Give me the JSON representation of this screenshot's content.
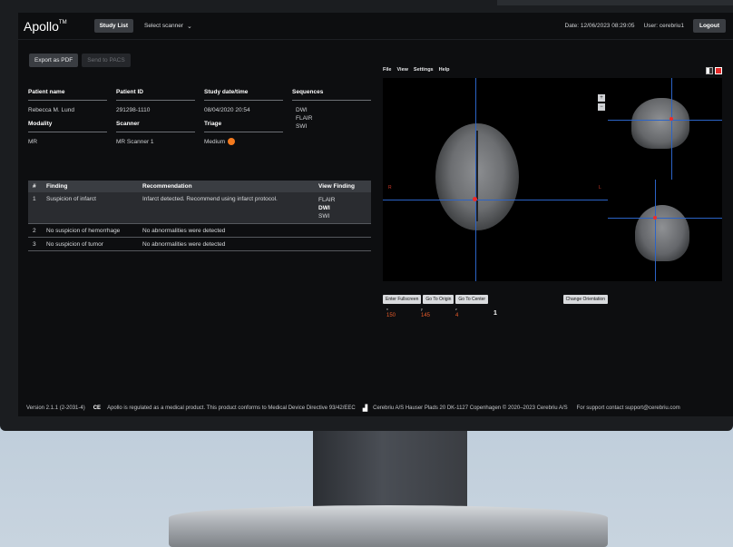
{
  "app": {
    "brand": "Apollo",
    "brand_tm": "TM",
    "tab_study_list": "Study List",
    "scanner_select": "Select scanner",
    "date": "Date: 12/06/2023 08:29:05",
    "user": "User: cerebriu1",
    "logout": "Logout"
  },
  "actions": {
    "export_pdf": "Export as PDF",
    "send_pacs": "Send to PACS"
  },
  "patient": {
    "name_label": "Patient name",
    "name_value": "Rebecca M. Lund",
    "id_label": "Patient ID",
    "id_value": "291298-1110",
    "date_label": "Study date/time",
    "date_value": "08/04/2020 20:54",
    "sequences_label": "Sequences",
    "sequences": [
      "DWI",
      "FLAIR",
      "SWI"
    ],
    "modality_label": "Modality",
    "modality_value": "MR",
    "scanner_label": "Scanner",
    "scanner_value": "MR Scanner 1",
    "triage_label": "Triage",
    "triage_value": "Medium",
    "triage_color": "#f47a1e"
  },
  "findings": {
    "headers": [
      "#",
      "Finding",
      "Recommendation",
      "View Finding"
    ],
    "rows": [
      {
        "num": "1",
        "finding": "Suspicion of infarct",
        "rec": "Infarct detected. Recommend using infarct protocol.",
        "views": [
          "FLAIR",
          "DWI",
          "SWI"
        ]
      },
      {
        "num": "2",
        "finding": "No suspicion of hemorrhage",
        "rec": "No abnormalities were detected"
      },
      {
        "num": "3",
        "finding": "No suspicion of tumor",
        "rec": "No abnormalities were detected"
      }
    ]
  },
  "viewer": {
    "menu": [
      "File",
      "View",
      "Settings",
      "Help"
    ],
    "orient_left": "R",
    "orient_right": "L",
    "zoom_in": "+",
    "zoom_out": "−",
    "btn_fullscreen": "Enter Fullscreen",
    "btn_origin": "Go To Origin",
    "btn_center": "Go To Center",
    "btn_orientation": "Change Orientation",
    "coord_labels": [
      "x",
      "y",
      "z"
    ],
    "coords": [
      "150",
      "145",
      "4"
    ],
    "slice": "1"
  },
  "footer": {
    "version": "Version 2.1.1 (2-2031-4)",
    "ce": "CE",
    "regulatory": "Apollo is regulated as a medical product. This product conforms to Medical Device Directive 93/42/EEC",
    "address": "Cerebriu A/S Hauser Plads 20 DK-1127 Copenhagen © 2020–2023 Cerebriu A/S",
    "support": "For support contact support@cerebriu.com"
  },
  "accent_colors": {
    "lesion": "#ee2a2a",
    "crosshair": "#2b63c6",
    "coords": "#e85b2a"
  }
}
